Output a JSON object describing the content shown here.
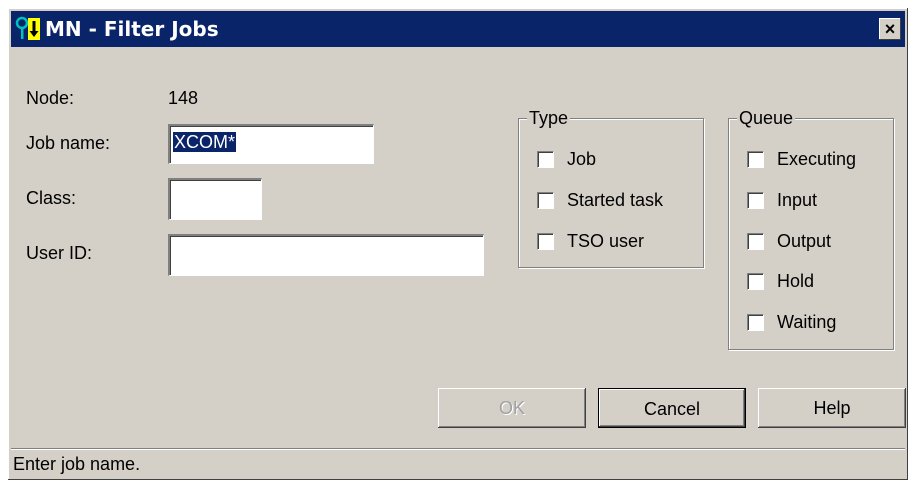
{
  "window": {
    "title": "MN - Filter Jobs",
    "app_icon": "key-arrow-icon",
    "close_glyph": "×",
    "colors": {
      "titlebar": "#0a246a",
      "face": "#d4d0c8",
      "selection": "#0a246a"
    }
  },
  "form": {
    "node_label": "Node:",
    "node_value": "148",
    "job_name_label": "Job name:",
    "job_name_value": "XCOM*",
    "class_label": "Class:",
    "class_value": "",
    "user_id_label": "User ID:",
    "user_id_value": ""
  },
  "type_group": {
    "legend": "Type",
    "options": [
      {
        "label": "Job",
        "checked": false
      },
      {
        "label": "Started task",
        "checked": false
      },
      {
        "label": "TSO user",
        "checked": false
      }
    ]
  },
  "queue_group": {
    "legend": "Queue",
    "options": [
      {
        "label": "Executing",
        "checked": false
      },
      {
        "label": "Input",
        "checked": false
      },
      {
        "label": "Output",
        "checked": false
      },
      {
        "label": "Hold",
        "checked": false
      },
      {
        "label": "Waiting",
        "checked": false
      }
    ]
  },
  "buttons": {
    "ok": "OK",
    "cancel": "Cancel",
    "help": "Help"
  },
  "status": {
    "text": "Enter job name."
  }
}
